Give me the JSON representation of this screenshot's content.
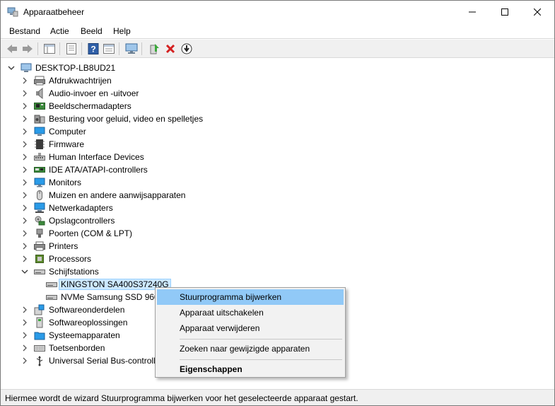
{
  "window": {
    "title": "Apparaatbeheer"
  },
  "menu": [
    "Bestand",
    "Actie",
    "Beeld",
    "Help"
  ],
  "toolbar": [
    "back-icon",
    "forward-icon",
    "properties-pane-icon",
    "device-list-icon",
    "help-icon",
    "show-hidden-icon",
    "monitor-scan-icon",
    "update-driver-icon",
    "uninstall-icon",
    "download-icon"
  ],
  "tree": {
    "root": "DESKTOP-LB8UD21",
    "categories": [
      {
        "label": "Afdrukwachtrijen",
        "icon": "printer-queue-icon"
      },
      {
        "label": "Audio-invoer en -uitvoer",
        "icon": "speaker-icon"
      },
      {
        "label": "Beeldschermadapters",
        "icon": "display-adapter-icon"
      },
      {
        "label": "Besturing voor geluid, video en spelletjes",
        "icon": "sound-controller-icon"
      },
      {
        "label": "Computer",
        "icon": "computer-icon"
      },
      {
        "label": "Firmware",
        "icon": "firmware-icon"
      },
      {
        "label": "Human Interface Devices",
        "icon": "hid-icon"
      },
      {
        "label": "IDE ATA/ATAPI-controllers",
        "icon": "ide-controller-icon"
      },
      {
        "label": "Monitors",
        "icon": "monitor-icon"
      },
      {
        "label": "Muizen en andere aanwijsapparaten",
        "icon": "mouse-icon"
      },
      {
        "label": "Netwerkadapters",
        "icon": "network-adapter-icon"
      },
      {
        "label": "Opslagcontrollers",
        "icon": "storage-controller-icon"
      },
      {
        "label": "Poorten (COM & LPT)",
        "icon": "port-icon"
      },
      {
        "label": "Printers",
        "icon": "printer-icon"
      },
      {
        "label": "Processors",
        "icon": "processor-icon"
      },
      {
        "label": "Schijfstations",
        "icon": "disk-drive-icon",
        "expanded": true,
        "children": [
          {
            "label": "KINGSTON SA400S37240G",
            "icon": "disk-icon",
            "selected": true
          },
          {
            "label": "NVMe Samsung SSD 960",
            "icon": "disk-icon"
          }
        ]
      },
      {
        "label": "Softwareonderdelen",
        "icon": "software-component-icon"
      },
      {
        "label": "Softwareoplossingen",
        "icon": "software-device-icon"
      },
      {
        "label": "Systeemapparaten",
        "icon": "system-folder-icon"
      },
      {
        "label": "Toetsenborden",
        "icon": "keyboard-icon"
      },
      {
        "label": "Universal Serial Bus-controllers",
        "icon": "usb-icon"
      }
    ]
  },
  "context_menu": {
    "items": [
      {
        "label": "Stuurprogramma bijwerken",
        "highlighted": true
      },
      {
        "label": "Apparaat uitschakelen"
      },
      {
        "label": "Apparaat verwijderen"
      },
      {
        "label": "Zoeken naar gewijzigde apparaten"
      },
      {
        "label": "Eigenschappen",
        "bold": true
      }
    ]
  },
  "status": "Hiermee wordt de wizard Stuurprogramma bijwerken voor het geselecteerde apparaat gestart."
}
